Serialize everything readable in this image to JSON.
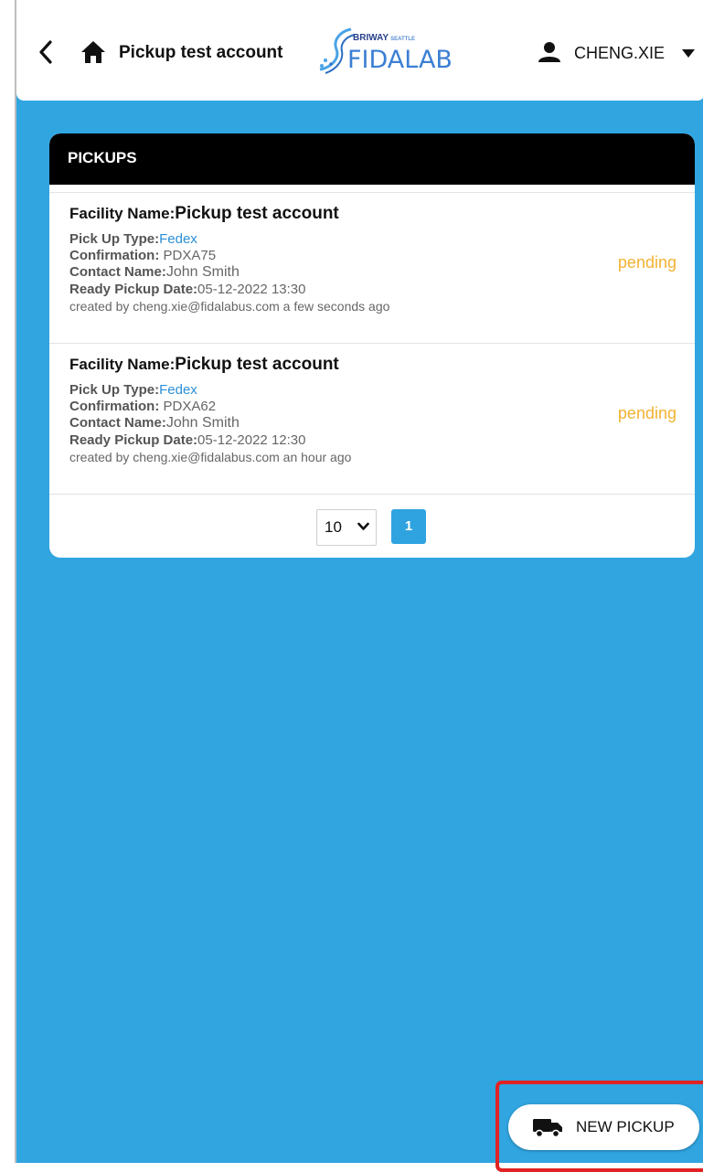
{
  "header": {
    "title": "Pickup test account",
    "logo_top": "BRIWAY",
    "logo_top_small": "SEATTLE",
    "logo_main": "FIDALAB",
    "user": "CHENG.XIE"
  },
  "card": {
    "title": "PICKUPS",
    "items": [
      {
        "facility_label": "Facility Name:",
        "facility_value": "Pickup test account",
        "type_label": "Pick Up Type:",
        "type_value": "Fedex",
        "confirmation_label": "Confirmation:",
        "confirmation_value": "PDXA75",
        "contact_label": "Contact Name:",
        "contact_value": "John Smith",
        "date_label": "Ready Pickup Date:",
        "date_value": "05-12-2022 13:30",
        "created": "created by cheng.xie@fidalabus.com a few seconds ago",
        "status": "pending"
      },
      {
        "facility_label": "Facility Name:",
        "facility_value": "Pickup test account",
        "type_label": "Pick Up Type:",
        "type_value": "Fedex",
        "confirmation_label": "Confirmation:",
        "confirmation_value": "PDXA62",
        "contact_label": "Contact Name:",
        "contact_value": "John Smith",
        "date_label": "Ready Pickup Date:",
        "date_value": "05-12-2022 12:30",
        "created": "created by cheng.xie@fidalabus.com an hour ago",
        "status": "pending"
      }
    ],
    "pager": {
      "page_size": "10",
      "current_page": "1"
    }
  },
  "fab": {
    "label": "NEW PICKUP"
  },
  "colors": {
    "background": "#30a5e0",
    "status_pending": "#f2b233",
    "link": "#2b8fd6",
    "highlight": "#e02323"
  }
}
